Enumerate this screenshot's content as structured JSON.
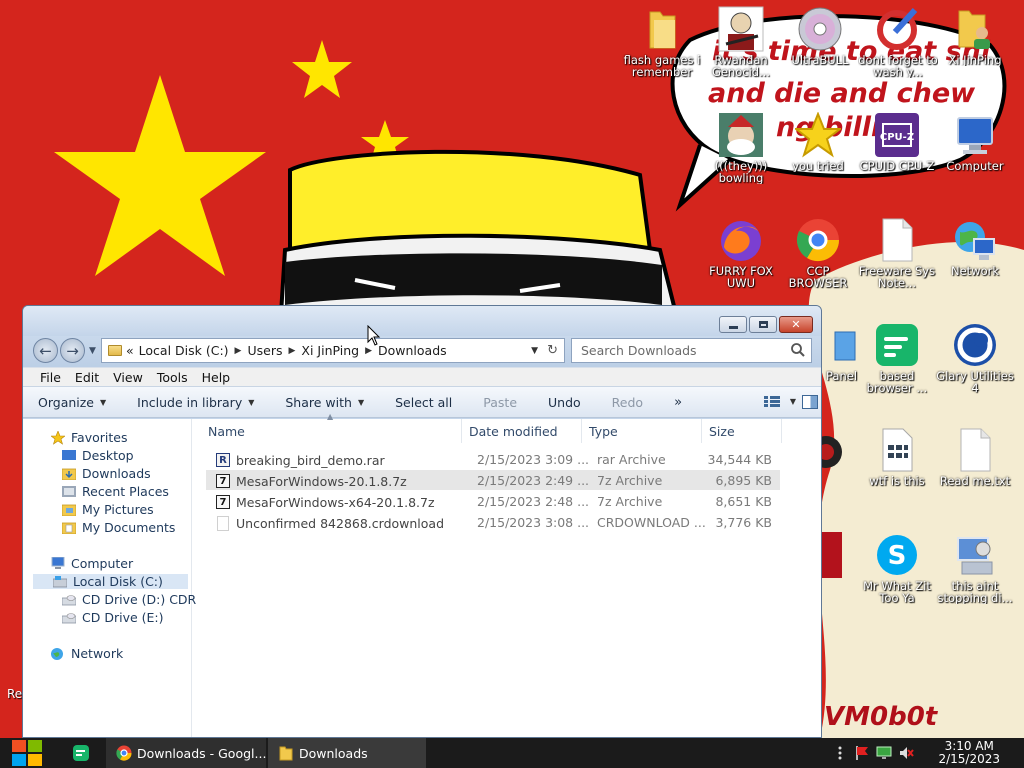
{
  "desktop": {
    "wallpaper_text_line1": "it's time to eat shi",
    "wallpaper_text_line2": "and die and chew",
    "wallpaper_text_line3": "ng billi",
    "wallpaper_signature": "VM0b0t",
    "partial_left_label": "Re",
    "icons": [
      {
        "label": "flash games i remember",
        "icon": "folder-icon"
      },
      {
        "label": "Rwandan Genocid...",
        "icon": "soldier-meme-icon"
      },
      {
        "label": "UltraBULL",
        "icon": "cd-icon"
      },
      {
        "label": "dont forget to wash y...",
        "icon": "ccleaner-icon"
      },
      {
        "label": "Xi JinPing",
        "icon": "user-folder-icon"
      },
      {
        "label": "(((they))) bowling",
        "icon": "santa-meme-icon"
      },
      {
        "label": "you tried",
        "icon": "gold-star-icon"
      },
      {
        "label": "CPUID CPU-Z",
        "icon": "cpuz-icon"
      },
      {
        "label": "Computer",
        "icon": "computer-icon"
      },
      {
        "label": "FURRY FOX UWU",
        "icon": "firefox-icon"
      },
      {
        "label": "CCP BROWSER",
        "icon": "chrome-icon"
      },
      {
        "label": "Freeware Sys Note...",
        "icon": "document-icon"
      },
      {
        "label": "Network",
        "icon": "network-globe-icon"
      },
      {
        "label": "Panel",
        "icon": "control-panel-icon"
      },
      {
        "label": "based browser ...",
        "icon": "green-chat-icon"
      },
      {
        "label": "Glary Utilities 4",
        "icon": "glary-icon"
      },
      {
        "label": "wtf is this",
        "icon": "grid-document-icon"
      },
      {
        "label": "Read me.txt",
        "icon": "text-file-icon"
      },
      {
        "label": "Mr What Zit Too Ya",
        "icon": "skype-icon"
      },
      {
        "label": "this aint stopping di...",
        "icon": "installer-icon"
      }
    ]
  },
  "explorer": {
    "window_title": "Downloads",
    "address": {
      "overflow": "«",
      "crumbs": [
        "Local Disk (C:)",
        "Users",
        "Xi JinPing",
        "Downloads"
      ]
    },
    "search": {
      "placeholder": "Search Downloads"
    },
    "menu": [
      "File",
      "Edit",
      "View",
      "Tools",
      "Help"
    ],
    "commands": {
      "organize": "Organize",
      "include": "Include in library",
      "share": "Share with",
      "select_all": "Select all",
      "paste": "Paste",
      "undo": "Undo",
      "redo": "Redo",
      "more": "»"
    },
    "nav": {
      "favorites": "Favorites",
      "desktop": "Desktop",
      "downloads": "Downloads",
      "recent": "Recent Places",
      "pictures": "My Pictures",
      "documents": "My Documents",
      "computer": "Computer",
      "local_disk": "Local Disk (C:)",
      "cd_d": "CD Drive (D:) CDR",
      "cd_e": "CD Drive (E:)",
      "network": "Network"
    },
    "columns": {
      "name": "Name",
      "date": "Date modified",
      "type": "Type",
      "size": "Size"
    },
    "files": [
      {
        "name": "breaking_bird_demo.rar",
        "date": "2/15/2023 3:09 ...",
        "type": "rar Archive",
        "size": "34,544 KB",
        "icon": "rar-archive-icon",
        "selected": false
      },
      {
        "name": "MesaForWindows-20.1.8.7z",
        "date": "2/15/2023 2:49 ...",
        "type": "7z Archive",
        "size": "6,895 KB",
        "icon": "7z-archive-icon",
        "selected": true
      },
      {
        "name": "MesaForWindows-x64-20.1.8.7z",
        "date": "2/15/2023 2:48 ...",
        "type": "7z Archive",
        "size": "8,651 KB",
        "icon": "7z-archive-icon",
        "selected": false
      },
      {
        "name": "Unconfirmed 842868.crdownload",
        "date": "2/15/2023 3:08 ...",
        "type": "CRDOWNLOAD ...",
        "size": "3,776 KB",
        "icon": "blank-file-icon",
        "selected": false
      }
    ]
  },
  "taskbar": {
    "tasks": [
      {
        "label": "Downloads - Googl...",
        "icon": "chrome-icon"
      },
      {
        "label": "Downloads",
        "icon": "folder-icon"
      }
    ],
    "clock": {
      "time": "3:10 AM",
      "date": "2/15/2023"
    }
  },
  "colors": {
    "wallpaper_red": "#d4251d",
    "star_yellow": "#ffe600",
    "taskbar": "#1b1b1b",
    "window_frame": "#c4d5ea"
  }
}
